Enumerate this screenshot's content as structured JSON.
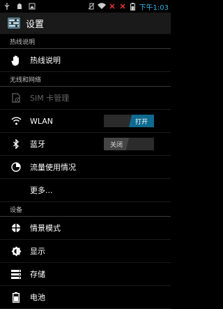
{
  "status": {
    "time": "下午1:03",
    "icons": [
      "usb-icon",
      "android-icon",
      "image-icon",
      "no-sim-icon",
      "wifi-icon",
      "signal-x-icon",
      "signal-x-icon",
      "battery-icon"
    ]
  },
  "app": {
    "title": "设置"
  },
  "sections": {
    "hotline": "热线说明",
    "wireless": "无线和网络",
    "device": "设备"
  },
  "items": {
    "hotline": "热线说明",
    "sim": "SIM 卡管理",
    "wlan": "WLAN",
    "bluetooth": "蓝牙",
    "data_usage": "流量使用情况",
    "more": "更多...",
    "profiles": "情景模式",
    "display": "显示",
    "storage": "存储",
    "battery": "电池"
  },
  "toggles": {
    "wlan": "打开",
    "bluetooth": "关闭"
  }
}
